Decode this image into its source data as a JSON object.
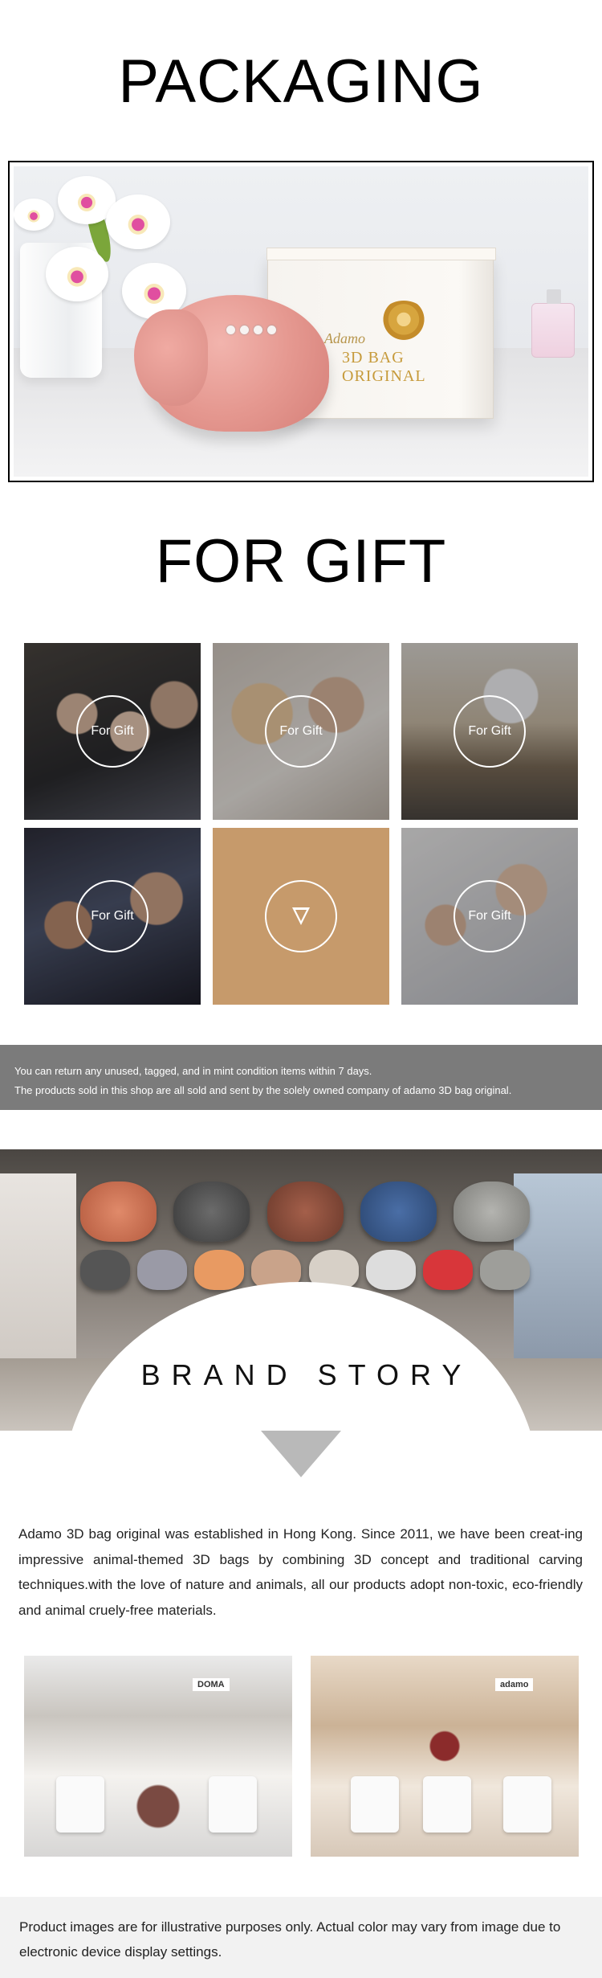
{
  "packaging": {
    "title": "PACKAGING",
    "box_brand_script": "Adamo",
    "box_brand_text": "3D BAG ORIGINAL"
  },
  "gift": {
    "title": "FOR GIFT",
    "tiles": [
      {
        "label": "For Gift"
      },
      {
        "label": "For Gift"
      },
      {
        "label": "For Gift"
      },
      {
        "label": "For Gift"
      },
      {
        "icon": "arrow-icon"
      },
      {
        "label": "For Gift"
      }
    ],
    "center_color": "#c69a6b"
  },
  "notice": {
    "line1": "You can return any unused, tagged, and in mint condition items within 7 days.",
    "line2": "The products sold in this shop are all sold and sent by the solely owned company of adamo 3D bag original."
  },
  "brand": {
    "title": "BRAND STORY",
    "story": "Adamo 3D bag original was established in Hong Kong. Since 2011, we have been creat-ing impressive animal-themed 3D bags by combining 3D concept and traditional carving techniques.with the love of nature and animals, all our products adopt non-toxic, eco-friendly and animal cruely-free materials.",
    "store_sign_1": "DOMA",
    "store_sign_2": "adamo"
  },
  "disclaimer": {
    "text": "Product images are for illustrative purposes only. Actual color may vary from image due to electronic device display settings."
  },
  "colors": {
    "notice_bg": "#7b7b7b",
    "disclaimer_bg": "#f2f2f2",
    "triangle": "#b9b9b9"
  }
}
